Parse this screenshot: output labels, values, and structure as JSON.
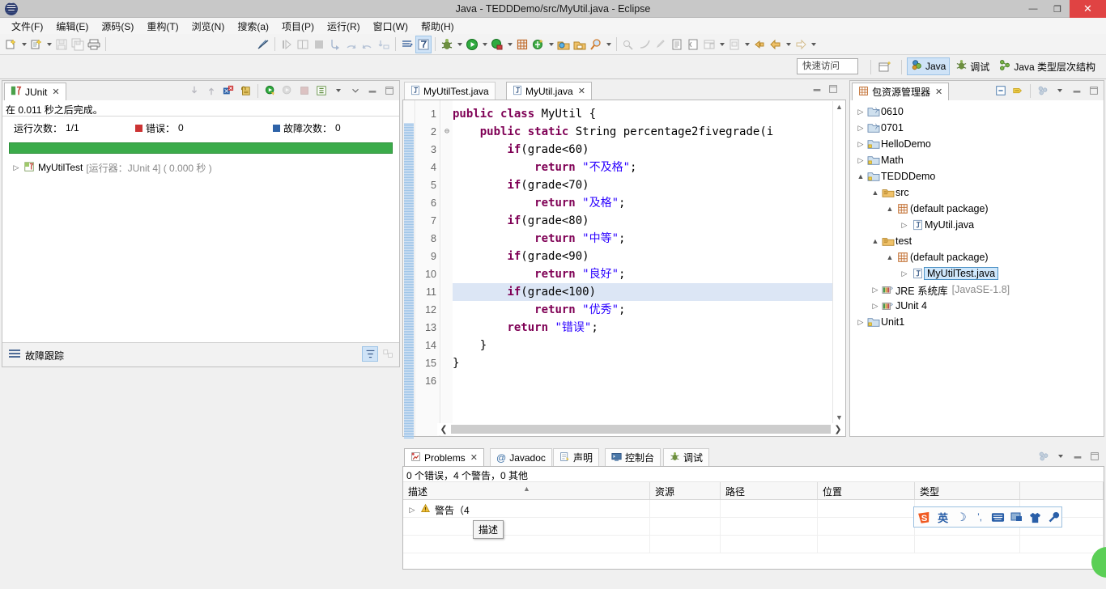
{
  "window": {
    "title": "Java - TEDDDemo/src/MyUtil.java - Eclipse",
    "app_icon": "eclipse-icon",
    "minimize": "—",
    "maximize": "❐",
    "close": "✕"
  },
  "menubar": {
    "items": [
      {
        "label": "文件(F)",
        "name": "menu-file"
      },
      {
        "label": "编辑(E)",
        "name": "menu-edit"
      },
      {
        "label": "源码(S)",
        "name": "menu-source"
      },
      {
        "label": "重构(T)",
        "name": "menu-refactor"
      },
      {
        "label": "浏览(N)",
        "name": "menu-navigate"
      },
      {
        "label": "搜索(a)",
        "name": "menu-search"
      },
      {
        "label": "项目(P)",
        "name": "menu-project"
      },
      {
        "label": "运行(R)",
        "name": "menu-run"
      },
      {
        "label": "窗口(W)",
        "name": "menu-window"
      },
      {
        "label": "帮助(H)",
        "name": "menu-help"
      }
    ]
  },
  "perspective": {
    "quick_access": "快速访问",
    "open_perspective_icon": "open-perspective-icon",
    "items": [
      {
        "label": "Java",
        "icon": "java-perspective-icon",
        "active": true
      },
      {
        "label": "调试",
        "icon": "debug-perspective-icon",
        "active": false
      },
      {
        "label": "Java 类型层次结构",
        "icon": "type-hierarchy-icon",
        "active": false
      }
    ]
  },
  "junit": {
    "tab_label": "JUnit",
    "tab_close": "✕",
    "status": "在 0.011 秒之后完成。",
    "counters": [
      {
        "label": "运行次数：",
        "value": "1/1",
        "icon": null
      },
      {
        "label": "错误：",
        "value": "0",
        "icon": "error-icon"
      },
      {
        "label": "故障次数：",
        "value": "0",
        "icon": "failure-icon"
      }
    ],
    "progress_color": "#3bab4a",
    "tree": [
      {
        "label": "MyUtilTest",
        "meta": "[运行器：JUnit 4] ( 0.000 秒 )",
        "icon": "test-class-icon"
      }
    ],
    "failure_trace_label": "故障跟踪"
  },
  "editor": {
    "tabs": [
      {
        "label": "MyUtilTest.java",
        "active": false,
        "icon": "java-file-icon"
      },
      {
        "label": "MyUtil.java",
        "active": true,
        "icon": "java-file-icon",
        "close": "✕"
      }
    ],
    "highlighted_line": 11,
    "lines": [
      {
        "n": 1,
        "tokens": [
          {
            "t": "public",
            "c": "kw"
          },
          {
            "t": " ",
            "c": "plain"
          },
          {
            "t": "class",
            "c": "kw"
          },
          {
            "t": " MyUtil {",
            "c": "plain"
          }
        ]
      },
      {
        "n": 2,
        "fold": true,
        "tokens": [
          {
            "t": "    ",
            "c": "plain"
          },
          {
            "t": "public",
            "c": "kw"
          },
          {
            "t": " ",
            "c": "plain"
          },
          {
            "t": "static",
            "c": "kw"
          },
          {
            "t": " String percentage2fivegrade(i",
            "c": "plain"
          }
        ]
      },
      {
        "n": 3,
        "tokens": [
          {
            "t": "        ",
            "c": "plain"
          },
          {
            "t": "if",
            "c": "kw"
          },
          {
            "t": "(grade<60)",
            "c": "plain"
          }
        ]
      },
      {
        "n": 4,
        "tokens": [
          {
            "t": "            ",
            "c": "plain"
          },
          {
            "t": "return",
            "c": "kw"
          },
          {
            "t": " ",
            "c": "plain"
          },
          {
            "t": "\"不及格\"",
            "c": "str"
          },
          {
            "t": ";",
            "c": "plain"
          }
        ]
      },
      {
        "n": 5,
        "tokens": [
          {
            "t": "        ",
            "c": "plain"
          },
          {
            "t": "if",
            "c": "kw"
          },
          {
            "t": "(grade<70)",
            "c": "plain"
          }
        ]
      },
      {
        "n": 6,
        "tokens": [
          {
            "t": "            ",
            "c": "plain"
          },
          {
            "t": "return",
            "c": "kw"
          },
          {
            "t": " ",
            "c": "plain"
          },
          {
            "t": "\"及格\"",
            "c": "str"
          },
          {
            "t": ";",
            "c": "plain"
          }
        ]
      },
      {
        "n": 7,
        "tokens": [
          {
            "t": "        ",
            "c": "plain"
          },
          {
            "t": "if",
            "c": "kw"
          },
          {
            "t": "(grade<80)",
            "c": "plain"
          }
        ]
      },
      {
        "n": 8,
        "tokens": [
          {
            "t": "            ",
            "c": "plain"
          },
          {
            "t": "return",
            "c": "kw"
          },
          {
            "t": " ",
            "c": "plain"
          },
          {
            "t": "\"中等\"",
            "c": "str"
          },
          {
            "t": ";",
            "c": "plain"
          }
        ]
      },
      {
        "n": 9,
        "tokens": [
          {
            "t": "        ",
            "c": "plain"
          },
          {
            "t": "if",
            "c": "kw"
          },
          {
            "t": "(grade<90)",
            "c": "plain"
          }
        ]
      },
      {
        "n": 10,
        "tokens": [
          {
            "t": "            ",
            "c": "plain"
          },
          {
            "t": "return",
            "c": "kw"
          },
          {
            "t": " ",
            "c": "plain"
          },
          {
            "t": "\"良好\"",
            "c": "str"
          },
          {
            "t": ";",
            "c": "plain"
          }
        ]
      },
      {
        "n": 11,
        "tokens": [
          {
            "t": "        ",
            "c": "plain"
          },
          {
            "t": "if",
            "c": "kw"
          },
          {
            "t": "(grade<100)",
            "c": "plain"
          }
        ]
      },
      {
        "n": 12,
        "tokens": [
          {
            "t": "            ",
            "c": "plain"
          },
          {
            "t": "return",
            "c": "kw"
          },
          {
            "t": " ",
            "c": "plain"
          },
          {
            "t": "\"优秀\"",
            "c": "str"
          },
          {
            "t": ";",
            "c": "plain"
          }
        ]
      },
      {
        "n": 13,
        "tokens": [
          {
            "t": "        ",
            "c": "plain"
          },
          {
            "t": "return",
            "c": "kw"
          },
          {
            "t": " ",
            "c": "plain"
          },
          {
            "t": "\"错误\"",
            "c": "str"
          },
          {
            "t": ";",
            "c": "plain"
          }
        ]
      },
      {
        "n": 14,
        "tokens": [
          {
            "t": "    }",
            "c": "plain"
          }
        ]
      },
      {
        "n": 15,
        "tokens": [
          {
            "t": "}",
            "c": "plain"
          }
        ]
      },
      {
        "n": 16,
        "tokens": []
      }
    ]
  },
  "package_explorer": {
    "tab_label": "包资源管理器",
    "tab_close": "✕",
    "tree": [
      {
        "label": "0610",
        "indent": 0,
        "twisty": "▷",
        "icon": "project-closed-icon"
      },
      {
        "label": "0701",
        "indent": 0,
        "twisty": "▷",
        "icon": "project-closed-icon"
      },
      {
        "label": "HelloDemo",
        "indent": 0,
        "twisty": "▷",
        "icon": "java-project-icon"
      },
      {
        "label": "Math",
        "indent": 0,
        "twisty": "▷",
        "icon": "java-project-icon"
      },
      {
        "label": "TEDDDemo",
        "indent": 0,
        "twisty": "▲",
        "icon": "java-project-icon"
      },
      {
        "label": "src",
        "indent": 1,
        "twisty": "▲",
        "icon": "source-folder-icon"
      },
      {
        "label": "(default package)",
        "indent": 2,
        "twisty": "▲",
        "icon": "package-icon"
      },
      {
        "label": "MyUtil.java",
        "indent": 3,
        "twisty": "▷",
        "icon": "java-file-icon"
      },
      {
        "label": "test",
        "indent": 1,
        "twisty": "▲",
        "icon": "source-folder-icon"
      },
      {
        "label": "(default package)",
        "indent": 2,
        "twisty": "▲",
        "icon": "package-icon"
      },
      {
        "label": "MyUtilTest.java",
        "indent": 3,
        "twisty": "▷",
        "icon": "java-file-icon",
        "selected": true
      },
      {
        "label": "JRE 系统库",
        "meta": "[JavaSE-1.8]",
        "indent": 1,
        "twisty": "▷",
        "icon": "library-icon"
      },
      {
        "label": "JUnit 4",
        "indent": 1,
        "twisty": "▷",
        "icon": "library-icon"
      },
      {
        "label": "Unit1",
        "indent": 0,
        "twisty": "▷",
        "icon": "java-project-icon"
      }
    ]
  },
  "problems": {
    "tabs": [
      {
        "label": "Problems",
        "active": true,
        "icon": "problems-icon",
        "close": "✕"
      },
      {
        "label": "Javadoc",
        "active": false,
        "icon": "javadoc-icon"
      },
      {
        "label": "声明",
        "active": false,
        "icon": "declaration-icon"
      },
      {
        "label": "控制台",
        "active": false,
        "icon": "console-icon"
      },
      {
        "label": "调试",
        "active": false,
        "icon": "debug-icon"
      }
    ],
    "summary": "0 个错误，4 个警告，0 其他",
    "columns": [
      "描述",
      "资源",
      "路径",
      "位置",
      "类型"
    ],
    "rows": [
      {
        "cells": [
          "警告（4",
          "",
          "",
          "",
          ""
        ],
        "twisty": "▷",
        "icon": "warning-icon"
      },
      {
        "cells": [
          "",
          "",
          "",
          "",
          ""
        ]
      },
      {
        "cells": [
          "",
          "",
          "",
          "",
          ""
        ]
      }
    ],
    "tooltip": "描述"
  },
  "ime": {
    "name": "sogou-ime-toolbar",
    "items": [
      {
        "name": "sogou-logo-icon",
        "glyph": "S"
      },
      {
        "name": "english-mode-icon",
        "glyph": "英"
      },
      {
        "name": "moon-icon",
        "glyph": "☽"
      },
      {
        "name": "punctuation-icon",
        "glyph": "，"
      },
      {
        "name": "keyboard-icon",
        "glyph": "⌨"
      },
      {
        "name": "toolbox-icon",
        "glyph": "🗔"
      },
      {
        "name": "skin-icon",
        "glyph": "👕"
      },
      {
        "name": "settings-wrench-icon",
        "glyph": "🔧"
      }
    ]
  },
  "toolbar": {
    "groups": [
      [
        {
          "name": "new-wizard-button",
          "icon": "new-file-icon",
          "dropdown": true,
          "enabled": true
        },
        {
          "name": "new-java-class-button",
          "icon": "new-class-icon",
          "dropdown": true,
          "enabled": true
        },
        {
          "name": "save-button",
          "icon": "save-icon",
          "enabled": false
        },
        {
          "name": "save-all-button",
          "icon": "save-all-icon",
          "enabled": false
        },
        {
          "name": "print-button",
          "icon": "print-icon",
          "enabled": true
        }
      ],
      [
        {
          "name": "toggle-markers-button",
          "icon": "pencil-strike-icon",
          "enabled": true
        }
      ],
      [
        {
          "name": "resume-button",
          "icon": "resume-icon",
          "enabled": false
        },
        {
          "name": "suspend-button",
          "icon": "suspend-icon",
          "enabled": false
        },
        {
          "name": "terminate-button",
          "icon": "terminate-icon",
          "enabled": false
        },
        {
          "name": "step-into-button",
          "icon": "step-into-icon",
          "enabled": false
        },
        {
          "name": "step-over-button",
          "icon": "step-over-icon",
          "enabled": false
        },
        {
          "name": "step-return-button",
          "icon": "step-return-icon",
          "enabled": false
        },
        {
          "name": "drop-to-frame-button",
          "icon": "drop-frame-icon",
          "enabled": false
        }
      ],
      [
        {
          "name": "toggle-breadcrumb-button",
          "icon": "breadcrumb-icon",
          "enabled": true
        },
        {
          "name": "new-junit-test-button",
          "icon": "junit-test-icon",
          "enabled": true,
          "active": true
        }
      ],
      [
        {
          "name": "debug-button",
          "icon": "debug-bug-icon",
          "dropdown": true,
          "enabled": true
        },
        {
          "name": "run-button",
          "icon": "run-play-icon",
          "dropdown": true,
          "enabled": true
        },
        {
          "name": "coverage-button",
          "icon": "coverage-icon",
          "dropdown": true,
          "enabled": true
        },
        {
          "name": "new-package-button",
          "icon": "new-package-icon",
          "enabled": true
        },
        {
          "name": "external-tools-button",
          "icon": "external-tools-icon",
          "dropdown": true,
          "enabled": true
        },
        {
          "name": "open-type-button",
          "icon": "open-type-icon",
          "enabled": true
        },
        {
          "name": "open-task-button",
          "icon": "open-task-icon",
          "enabled": true
        },
        {
          "name": "search-button",
          "icon": "search-icon",
          "dropdown": true,
          "enabled": true
        }
      ],
      [
        {
          "name": "next-annotation-button",
          "icon": "next-annotation-icon",
          "enabled": false
        },
        {
          "name": "previous-annotation-button",
          "icon": "prev-annotation-icon",
          "enabled": false
        },
        {
          "name": "last-edit-location-button",
          "icon": "last-edit-icon",
          "enabled": false
        },
        {
          "name": "show-whitespace-button",
          "icon": "whitespace-icon",
          "enabled": true
        },
        {
          "name": "show-source-button",
          "icon": "source-quick-icon",
          "enabled": true
        },
        {
          "name": "restore-layout-button",
          "icon": "restore-layout-icon",
          "dropdown": true,
          "enabled": false
        },
        {
          "name": "pin-editor-button",
          "icon": "pin-editor-icon",
          "dropdown": true,
          "enabled": false
        },
        {
          "name": "back-history-button",
          "icon": "back-quick-icon",
          "enabled": true
        },
        {
          "name": "back-button",
          "icon": "back-arrow-icon",
          "dropdown": true,
          "enabled": true
        },
        {
          "name": "forward-button",
          "icon": "forward-arrow-icon",
          "dropdown": true,
          "enabled": false
        }
      ]
    ]
  }
}
